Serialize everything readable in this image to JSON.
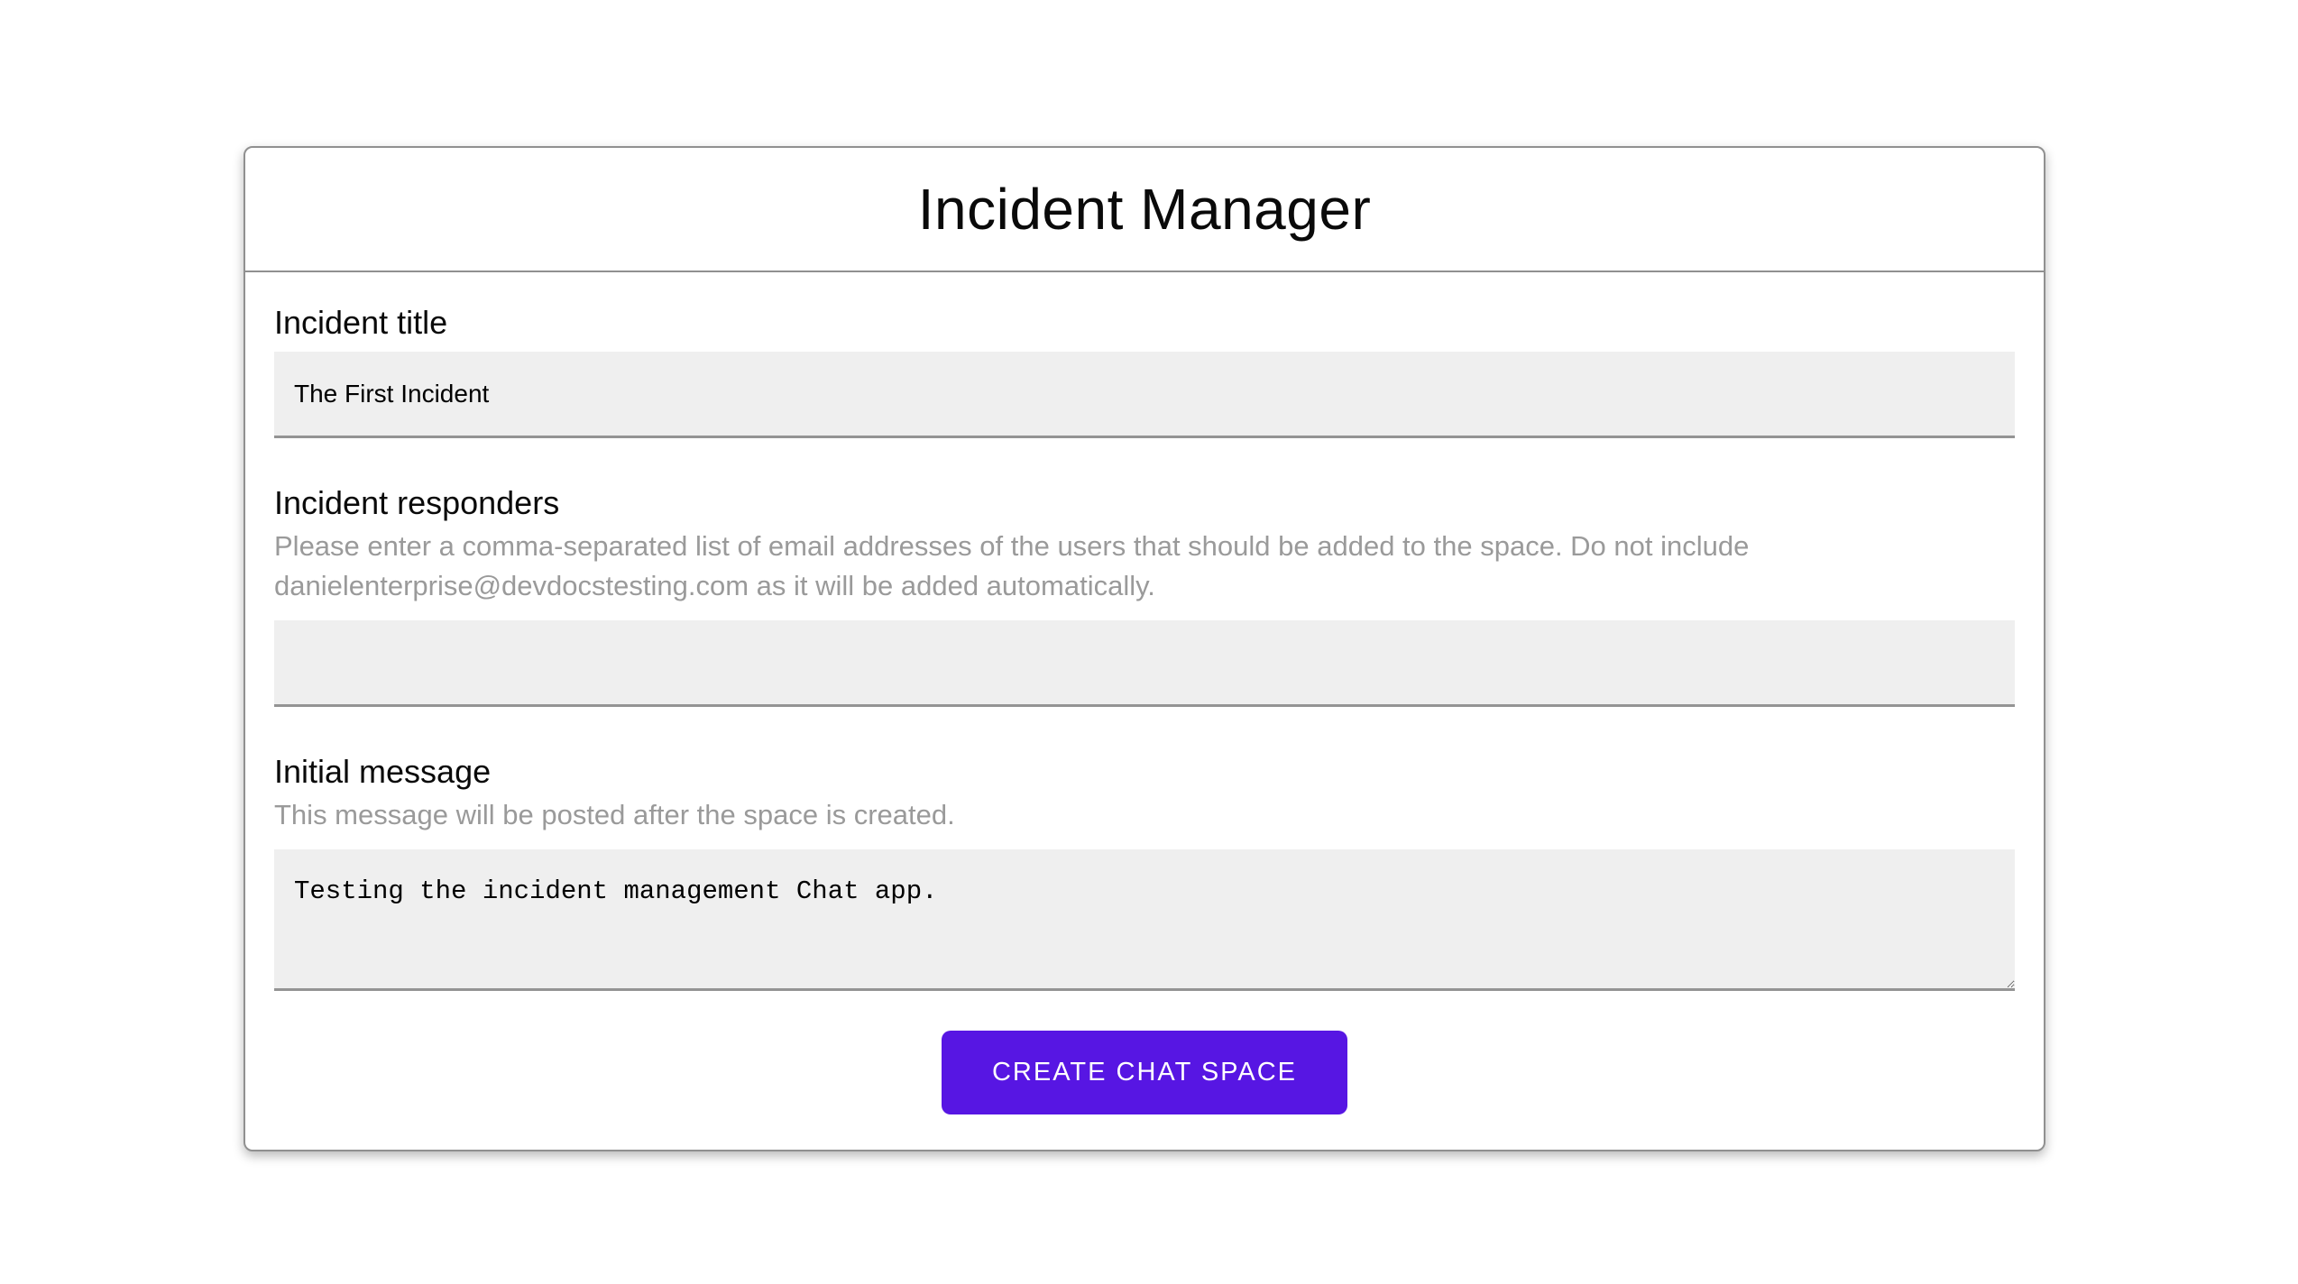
{
  "page": {
    "title": "Incident Manager"
  },
  "colors": {
    "accent": "#5716e3",
    "button_text": "#ffffff",
    "field_background": "#efefef",
    "field_underline": "#949494",
    "helper_text": "#9a9a9a",
    "card_border": "#909090"
  },
  "fields": {
    "incident_title": {
      "label": "Incident title",
      "value": "The First Incident",
      "placeholder": ""
    },
    "incident_responders": {
      "label": "Incident responders",
      "helper": "Please enter a comma-separated list of email addresses of the users that should be added to the space. Do not include danielenterprise@devdocstesting.com as it will be added automatically.",
      "value": "",
      "placeholder": ""
    },
    "initial_message": {
      "label": "Initial message",
      "helper": "This message will be posted after the space is created.",
      "value": "Testing the incident management Chat app."
    }
  },
  "actions": {
    "create_button_label": "CREATE CHAT SPACE"
  }
}
